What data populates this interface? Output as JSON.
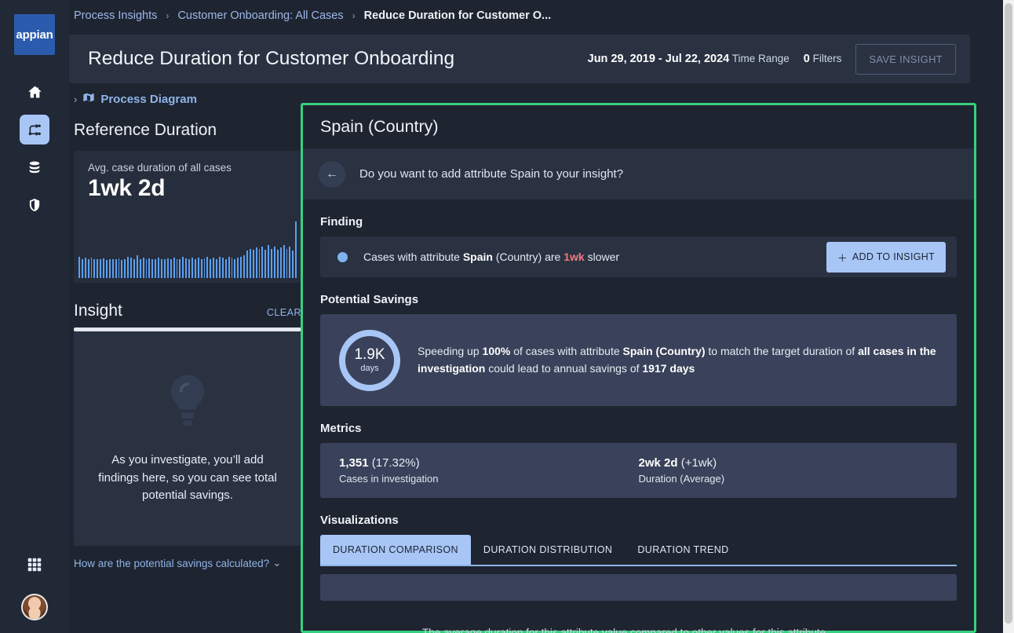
{
  "brand": {
    "logo_text": "appian",
    "accent": "#2b5bad"
  },
  "colors": {
    "page_bg": "#1e2430",
    "panel_bg": "#2a3242",
    "card_bg": "#39425a",
    "accent_blue": "#a8c6f5",
    "link_blue": "#8fb4e8",
    "highlight_green": "#37d081",
    "warning_red": "#f2797c"
  },
  "rail": {
    "items": [
      {
        "name": "home-icon",
        "label": "Home",
        "active": false
      },
      {
        "name": "process-icon",
        "label": "Process",
        "active": true
      },
      {
        "name": "database-icon",
        "label": "Data",
        "active": false
      },
      {
        "name": "shield-icon",
        "label": "Security",
        "active": false
      }
    ],
    "bottom": [
      {
        "name": "grid-apps-icon",
        "label": "Apps"
      },
      {
        "name": "avatar",
        "label": "User profile"
      }
    ]
  },
  "breadcrumb": {
    "items": [
      "Process Insights",
      "Customer Onboarding: All Cases"
    ],
    "current": "Reduce Duration for Customer O...",
    "separator": "›"
  },
  "header": {
    "title": "Reduce Duration for Customer Onboarding",
    "time_range_value": "Jun 29, 2019 - Jul 22, 2024",
    "time_range_label": "Time Range",
    "filters_count": "0",
    "filters_label": "Filters",
    "save_button": "SAVE INSIGHT"
  },
  "left": {
    "process_diagram_label": "Process Diagram",
    "process_diagram_chevron": "›",
    "reference_duration_title": "Reference Duration",
    "reference_card": {
      "label": "Avg. case duration of all cases",
      "value": "1wk 2d"
    },
    "insight_title": "Insight",
    "clear_label": "CLEAR",
    "insight_empty_text": "As you investigate, you’ll add findings here, so you can see total potential savings.",
    "savings_link": "How are the potential savings calculated?",
    "savings_link_chevron": "⌄"
  },
  "detail": {
    "title": "Spain (Country)",
    "question": "Do you want to add attribute Spain to your insight?",
    "back_icon": "←",
    "finding_title": "Finding",
    "finding": {
      "prefix": "Cases with attribute ",
      "attribute": "Spain",
      "mid": " (Country) are ",
      "delta": "1wk",
      "suffix": " slower"
    },
    "add_to_insight_button": "ADD TO INSIGHT",
    "add_to_insight_icon": "＋",
    "savings_title": "Potential Savings",
    "savings_ring_value": "1.9K",
    "savings_ring_unit": "days",
    "savings_text": {
      "p1": "Speeding up ",
      "b1": "100%",
      "p2": " of cases with attribute ",
      "b2": "Spain (Country)",
      "p3": " to match the target duration of ",
      "b3": "all cases in the investigation",
      "p4": " could lead to annual savings of ",
      "b4": "1917 days"
    },
    "metrics_title": "Metrics",
    "metrics": [
      {
        "value_bold": "1,351",
        "value_rest": " (17.32%)",
        "label": "Cases in investigation"
      },
      {
        "value_bold": "2wk 2d",
        "value_rest": " (+1wk)",
        "label": "Duration (Average)"
      }
    ],
    "visualizations_title": "Visualizations",
    "tabs": [
      {
        "label": "DURATION COMPARISON",
        "active": true
      },
      {
        "label": "DURATION DISTRIBUTION",
        "active": false
      },
      {
        "label": "DURATION TREND",
        "active": false
      }
    ],
    "viz_caption": "The average duration for this attribute value compared to other values for this attribute"
  },
  "chart_data": {
    "type": "bar",
    "title": "Avg. case duration of all cases",
    "xlabel": "",
    "ylabel": "",
    "grid": false,
    "legend": "none",
    "categories": [],
    "values": [
      38,
      34,
      36,
      33,
      36,
      33,
      34,
      33,
      35,
      32,
      33,
      34,
      33,
      35,
      32,
      34,
      38,
      36,
      34,
      40,
      34,
      36,
      33,
      35,
      34,
      33,
      36,
      34,
      33,
      35,
      33,
      36,
      34,
      33,
      38,
      35,
      33,
      36,
      34,
      36,
      33,
      35,
      38,
      34,
      36,
      33,
      38,
      36,
      34,
      38,
      36,
      33,
      36,
      38,
      40,
      48,
      52,
      50,
      54,
      52,
      56,
      50,
      58,
      52,
      56,
      50,
      54,
      58,
      52,
      56,
      48,
      100
    ],
    "ylim": [
      0,
      100
    ],
    "bar_color": "#5ba0f0"
  }
}
